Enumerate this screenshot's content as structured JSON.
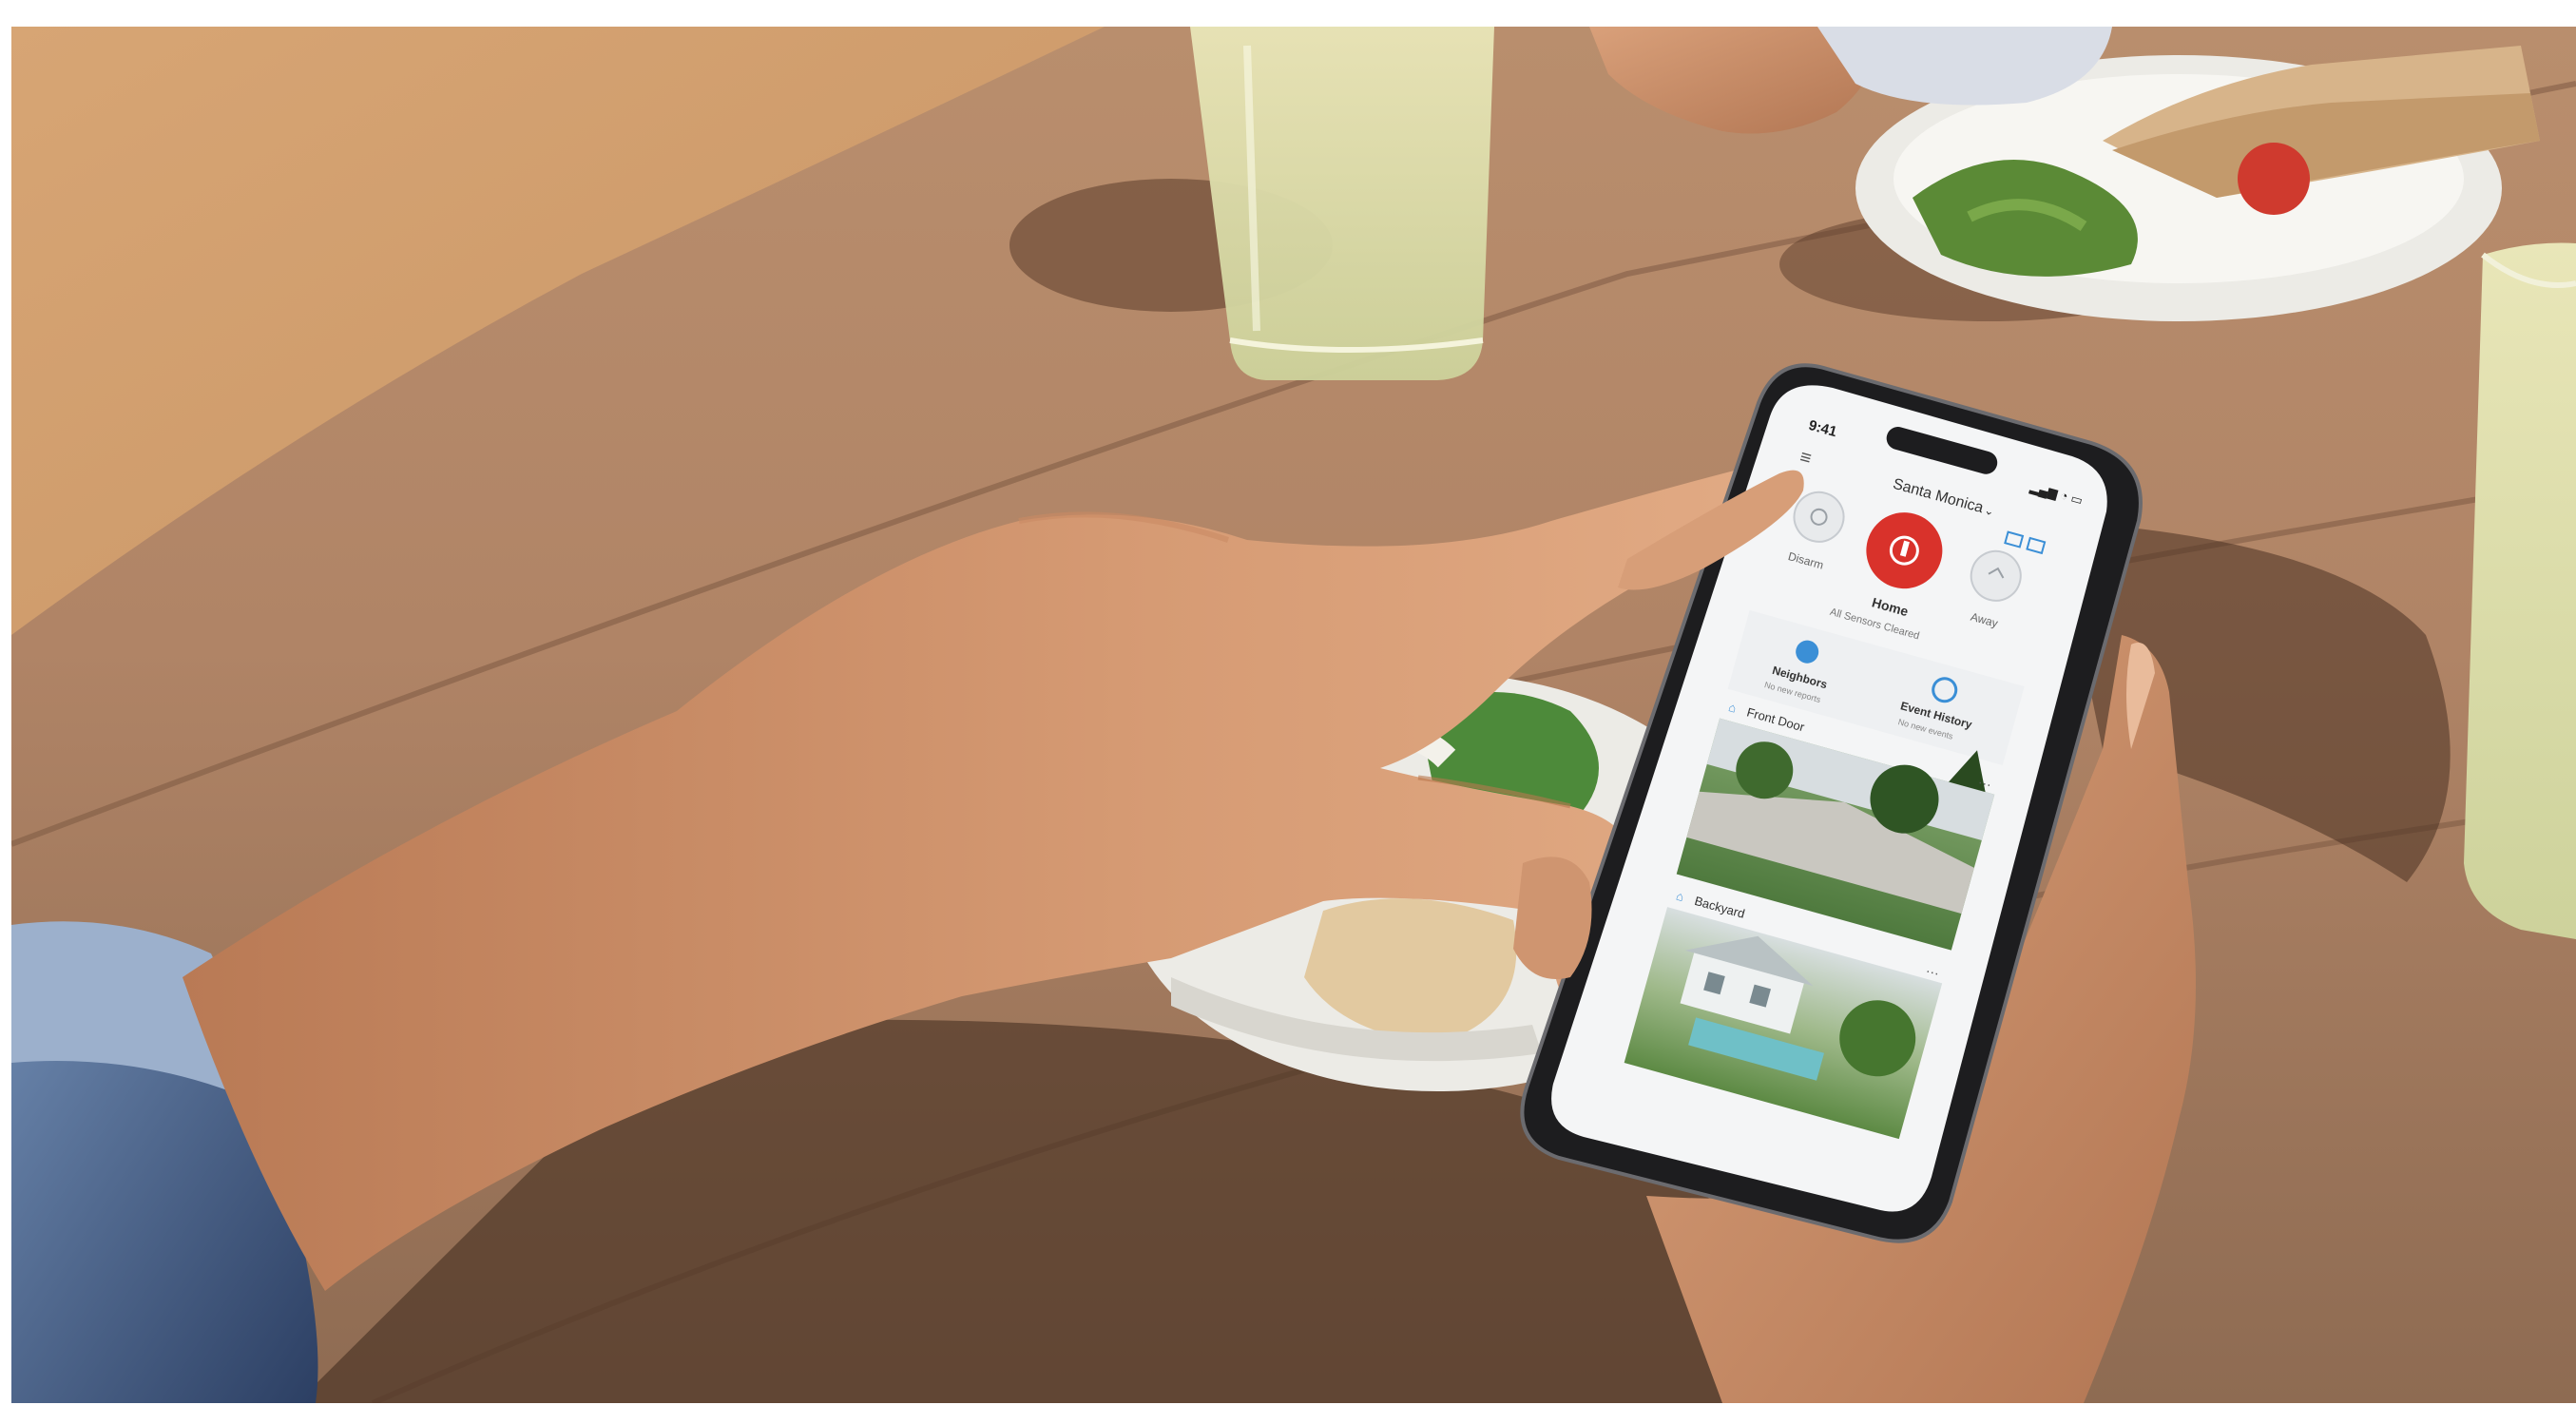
{
  "photo": {
    "description_tags": [
      "table",
      "hands",
      "smartphone",
      "drinks",
      "plates"
    ]
  },
  "phone": {
    "status_time": "9:41",
    "location_title": "Santa Monica",
    "modes": [
      {
        "label": "Disarm"
      },
      {
        "label": "Home",
        "sub": "All Sensors Cleared"
      },
      {
        "label": "Away"
      }
    ],
    "shortcuts": [
      {
        "label": "Neighbors",
        "sub": "No new reports"
      },
      {
        "label": "Event History",
        "sub": "No new events"
      }
    ],
    "cameras": [
      {
        "label": "Front Door"
      },
      {
        "label": "Backyard"
      }
    ],
    "colors": {
      "accent": "#d9322b",
      "shortcut_icon": "#3b8fd6",
      "screen_bg": "#f4f5f6"
    }
  }
}
